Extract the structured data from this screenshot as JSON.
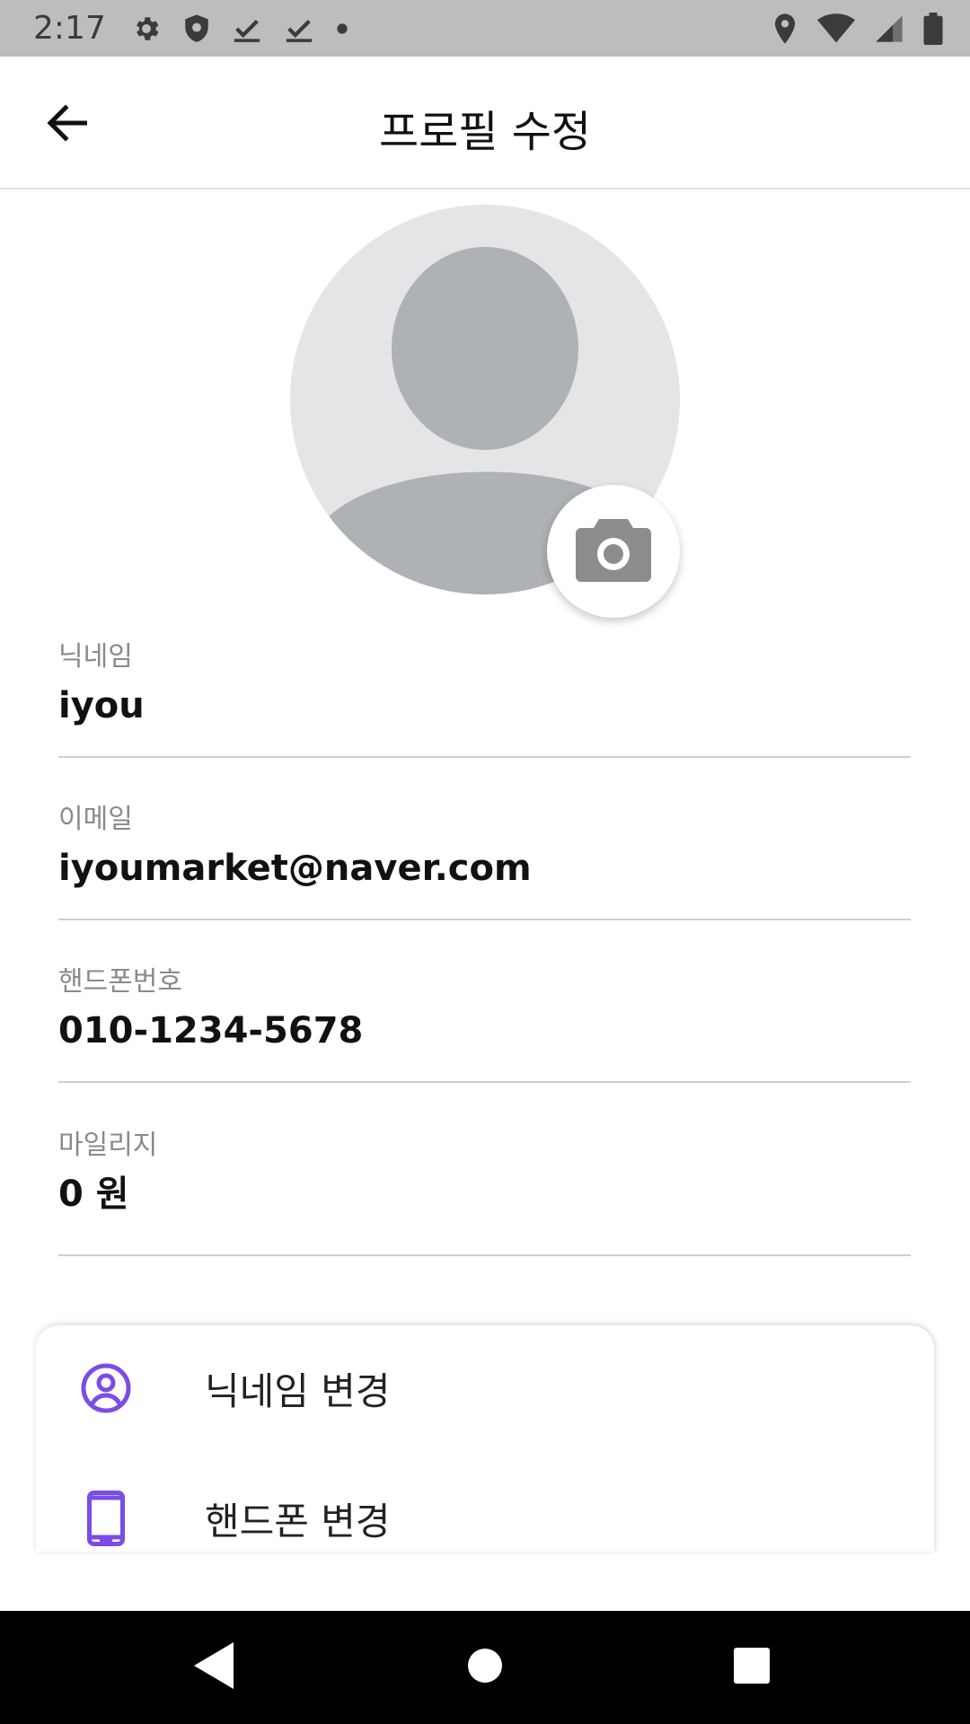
{
  "status_bar": {
    "time": "2:17",
    "left_icons": [
      "gear-icon",
      "shield-icon",
      "check-icon",
      "check-icon",
      "dot-icon"
    ],
    "right_icons": [
      "location-icon",
      "wifi-icon",
      "signal-icon",
      "battery-icon"
    ]
  },
  "app_bar": {
    "title": "프로필 수정",
    "back_icon": "arrow-left-icon"
  },
  "avatar": {
    "placeholder_icon": "person-icon",
    "camera_icon": "camera-icon"
  },
  "fields": [
    {
      "label": "닉네임",
      "value": "iyou"
    },
    {
      "label": "이메일",
      "value": "iyoumarket@naver.com"
    },
    {
      "label": "핸드폰번호",
      "value": "010-1234-5678"
    },
    {
      "label": "마일리지",
      "value": "0 원"
    }
  ],
  "menu": {
    "items": [
      {
        "label": "닉네임 변경",
        "icon": "user-circle-icon"
      },
      {
        "label": "핸드폰 변경",
        "icon": "smartphone-icon"
      }
    ]
  },
  "colors": {
    "accent": "#7b4ce6",
    "status_bar": "#bdbdbd",
    "nav_bar": "#000000",
    "avatar_bg": "#e4e5e7",
    "avatar_figure": "#aeb1b5"
  }
}
